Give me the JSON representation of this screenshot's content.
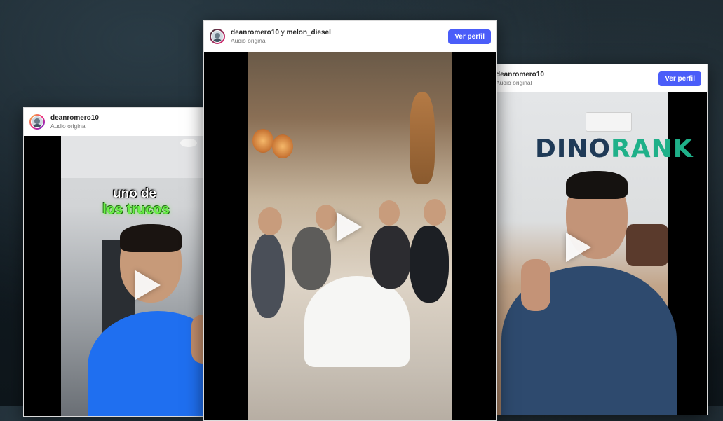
{
  "cards": {
    "left": {
      "username": "deanromero10",
      "subtitle": "Audio original",
      "video": {
        "caption_line1": "uno de",
        "caption_line2": "los trucos"
      }
    },
    "center": {
      "username": "deanromero10",
      "connector": "y",
      "coauthor": "melon_diesel",
      "subtitle": "Audio original",
      "button_label": "Ver perfil"
    },
    "right": {
      "username": "deanromero10",
      "subtitle": "Audio original",
      "button_label": "Ver perfil",
      "video": {
        "brand_part1": "DINO",
        "brand_part2": "RANK"
      }
    }
  },
  "colors": {
    "button_blue": "#4a5df9",
    "caption_green": "#6bf04a",
    "brand_navy": "#1f3a57",
    "brand_teal": "#1fb089"
  },
  "icons": {
    "play": "play-triangle",
    "avatar": "profile-avatar"
  }
}
